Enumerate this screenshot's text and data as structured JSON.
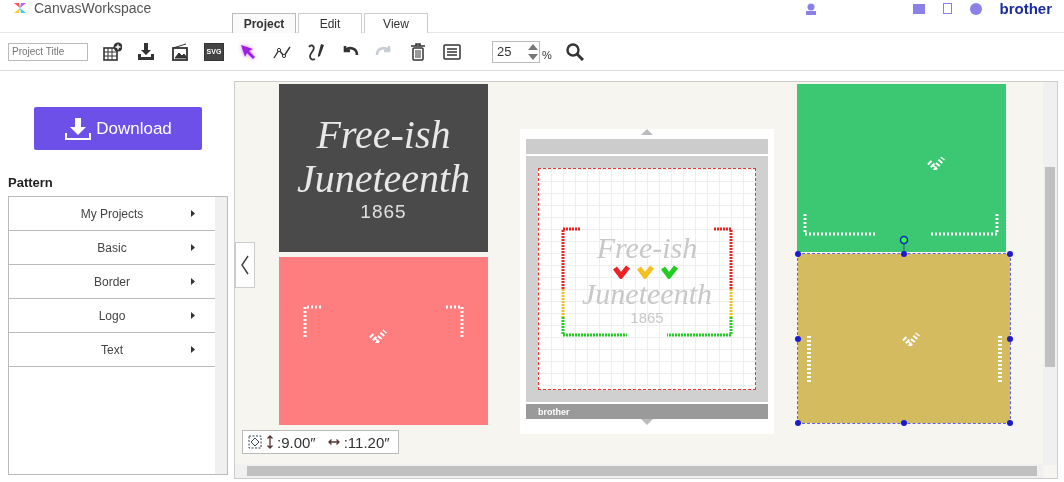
{
  "header": {
    "logo": "CanvasWorkspace",
    "brand": "brother"
  },
  "tabs": [
    {
      "label": "Project",
      "selected": true
    },
    {
      "label": "Edit",
      "selected": false
    },
    {
      "label": "View",
      "selected": false
    }
  ],
  "toolbar": {
    "project_title": {
      "placeholder": "Project Title"
    },
    "tools": [
      {
        "kind": "add-sheet",
        "selected": false,
        "disabled": false
      },
      {
        "kind": "import",
        "selected": false,
        "disabled": false
      },
      {
        "kind": "image",
        "selected": false,
        "disabled": false
      },
      {
        "kind": "svg",
        "label": "SVG",
        "selected": false,
        "disabled": false
      },
      {
        "kind": "select",
        "selected": true,
        "disabled": false
      },
      {
        "kind": "node",
        "selected": false,
        "disabled": false
      },
      {
        "kind": "draw",
        "selected": false,
        "disabled": false
      },
      {
        "kind": "undo",
        "selected": false,
        "disabled": false
      },
      {
        "kind": "redo",
        "selected": false,
        "disabled": true
      },
      {
        "kind": "delete",
        "selected": false,
        "disabled": false
      },
      {
        "kind": "list",
        "selected": false,
        "disabled": false
      }
    ],
    "zoom": {
      "value": "25",
      "unit": "%"
    }
  },
  "sidebar": {
    "download_button": "Download",
    "heading": "Pattern",
    "items": [
      {
        "label": "My Projects"
      },
      {
        "label": "Basic"
      },
      {
        "label": "Border"
      },
      {
        "label": "Logo"
      },
      {
        "label": "Text"
      }
    ]
  },
  "canvas": {
    "panels": [
      {
        "kind": "text-design",
        "color": "#4a4a4a",
        "selected": false,
        "lines": [
          "Free-ish",
          "Juneteenth",
          "1865"
        ]
      },
      {
        "kind": "corners-top",
        "color": "#fe7d7e",
        "selected": false
      },
      {
        "kind": "corners-bottom",
        "color": "#3cc872",
        "selected": false
      },
      {
        "kind": "sides",
        "color": "#d4bb60",
        "selected": true
      }
    ],
    "mat": {
      "lines": [
        "Free-ish",
        "Juneteenth",
        "1865"
      ],
      "brand": "brother"
    },
    "dimensions": {
      "height": ":9.00″",
      "width": ":11.20″"
    }
  }
}
